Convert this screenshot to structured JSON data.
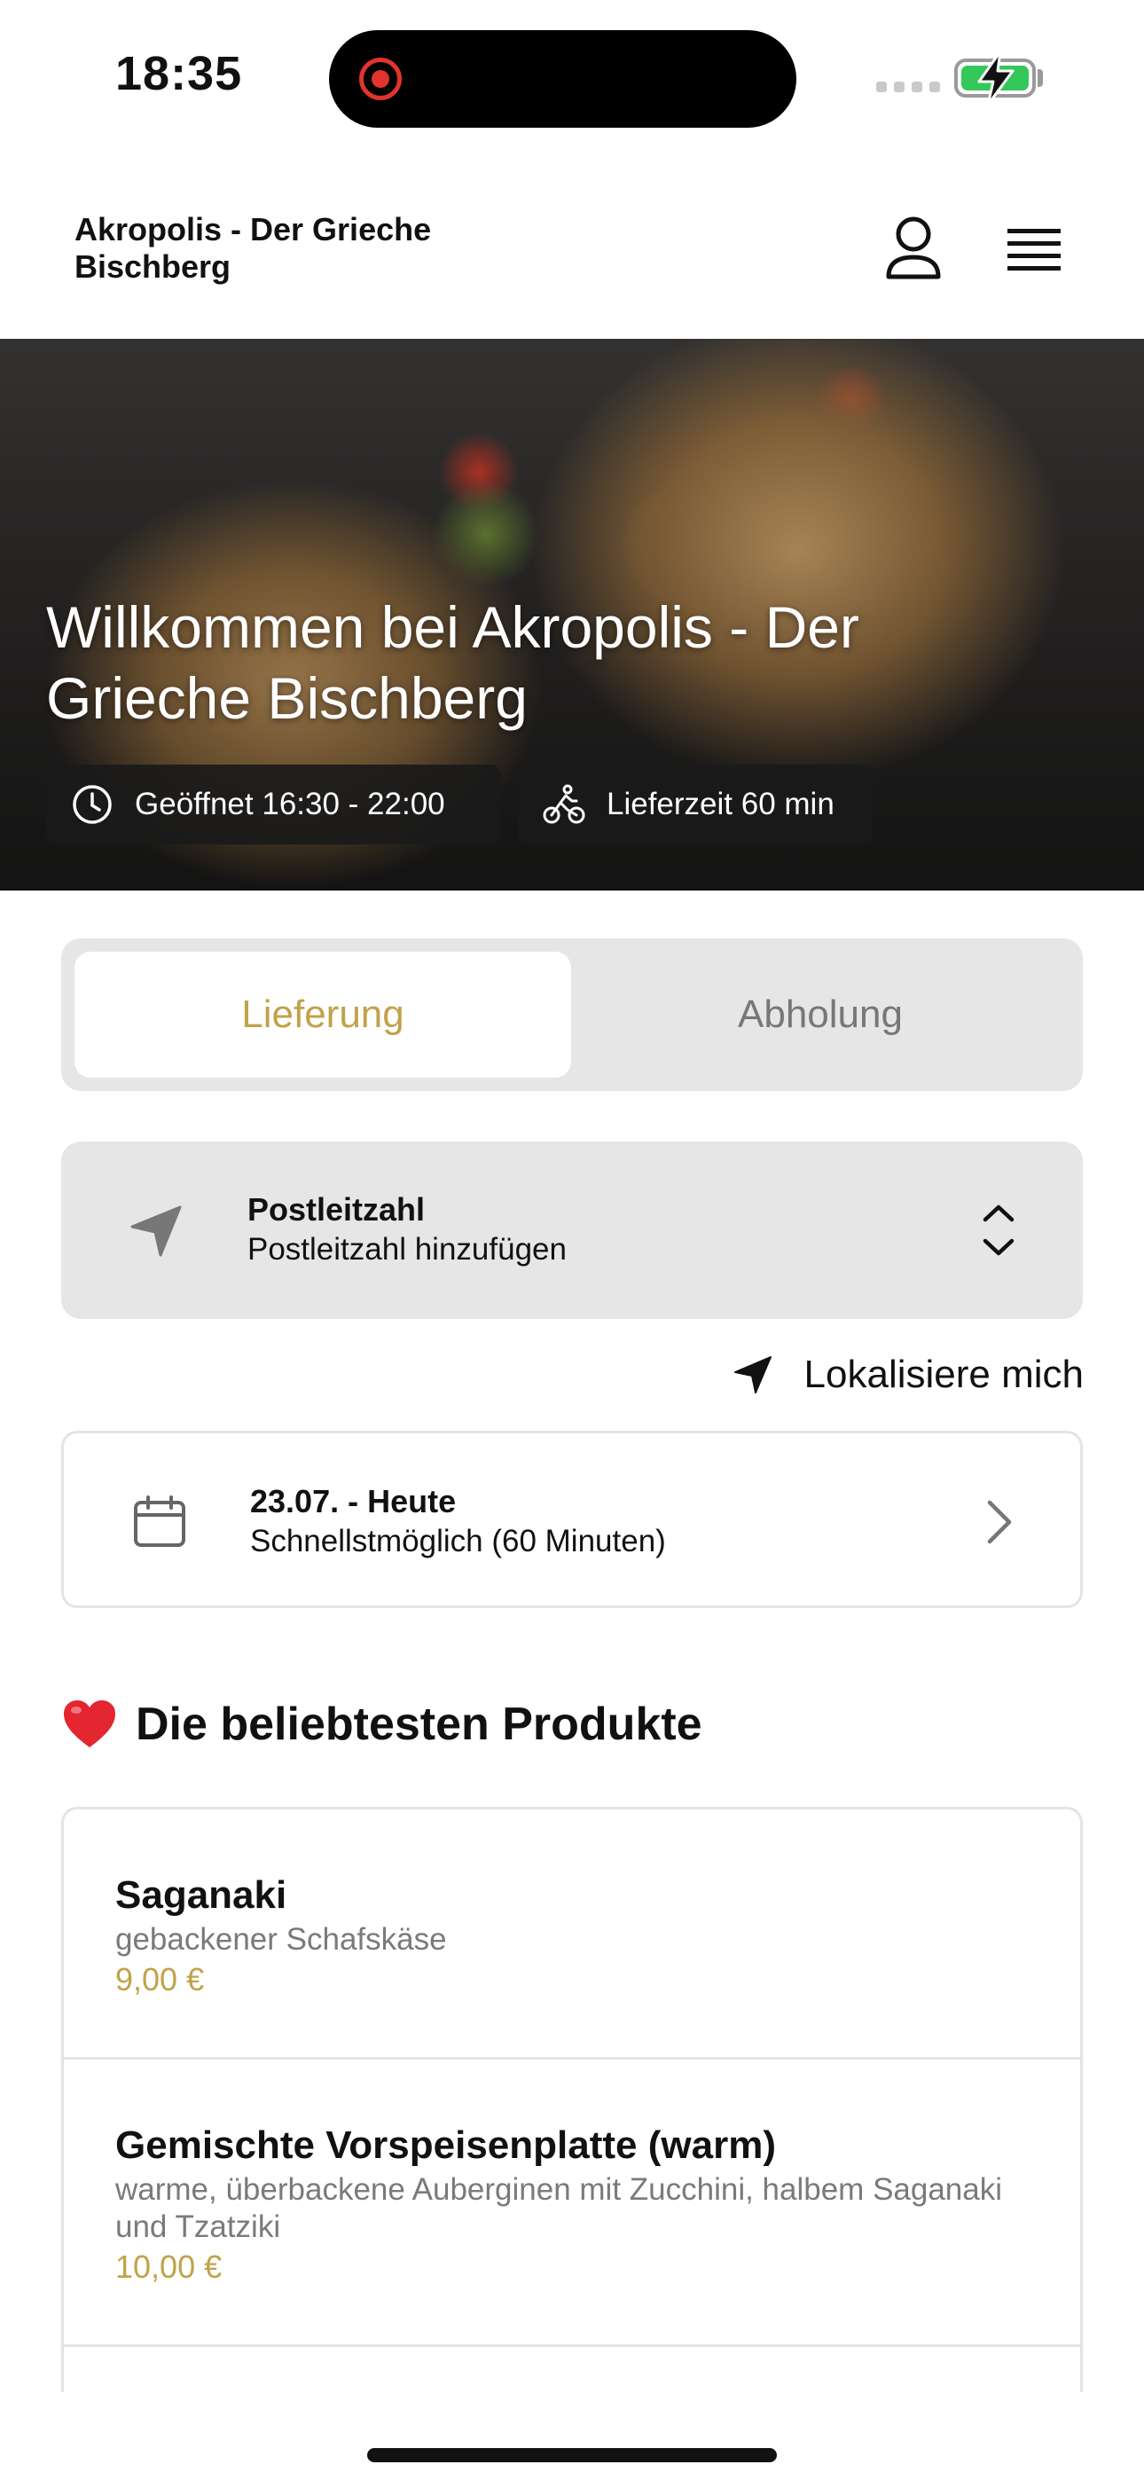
{
  "status_bar": {
    "time": "18:35"
  },
  "header": {
    "brand": "Akropolis - Der Grieche Bischberg"
  },
  "hero": {
    "title": "Willkommen bei Akropolis - Der Grieche Bischberg",
    "opening_hours": "Geöffnet 16:30 - 22:00",
    "delivery_time": "Lieferzeit 60 min"
  },
  "order_mode": {
    "delivery": "Lieferung",
    "pickup": "Abholung",
    "selected": "delivery"
  },
  "postal_code": {
    "label": "Postleitzahl",
    "placeholder": "Postleitzahl hinzufügen"
  },
  "locate": {
    "label": "Lokalisiere mich"
  },
  "schedule": {
    "date": "23.07. - Heute",
    "time": "Schnellstmöglich (60 Minuten)"
  },
  "popular": {
    "title": "Die beliebtesten Produkte",
    "products": [
      {
        "name": "Saganaki",
        "description": "gebackener Schafskäse",
        "price": "9,00 €"
      },
      {
        "name": "Gemischte Vorspeisenplatte (warm)",
        "description": "warme, überbackene Auberginen mit Zucchini, halbem Saganaki und Tzatziki",
        "price": "10,00 €"
      }
    ]
  },
  "colors": {
    "accent": "#c2a24a",
    "panel": "#e6e6e6",
    "battery": "#34c759",
    "record": "#e0342d",
    "heart": "#e3262f"
  }
}
